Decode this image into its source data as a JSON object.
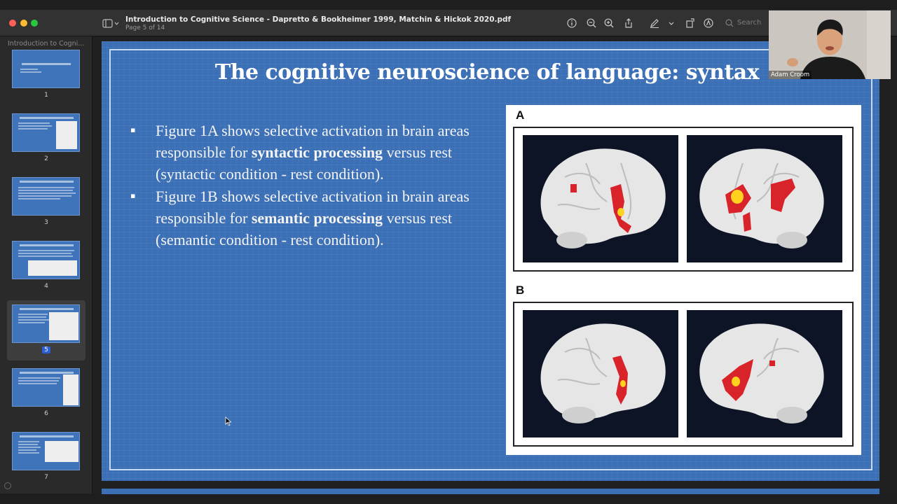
{
  "window": {
    "title": "Introduction to Cognitive Science - Dapretto & Bookheimer 1999, Matchin & Hickok 2020.pdf",
    "subtitle": "Page 5 of 14"
  },
  "toolbar": {
    "search_placeholder": "Search",
    "icons": [
      "info-icon",
      "zoom-out-icon",
      "zoom-in-icon",
      "share-icon",
      "markup-pen-icon",
      "chevron-down-icon",
      "rotate-icon",
      "annotate-icon"
    ]
  },
  "sidebar": {
    "title": "Introduction to Cogni...",
    "pages": [
      {
        "label": "1"
      },
      {
        "label": "2"
      },
      {
        "label": "3"
      },
      {
        "label": "4"
      },
      {
        "label": "5"
      },
      {
        "label": "6"
      },
      {
        "label": "7"
      }
    ],
    "selected_page": "5"
  },
  "slide": {
    "title": "The cognitive neuroscience of language: syntax",
    "bullet1": {
      "pre": "Figure 1A shows selective activation in brain areas responsible for ",
      "bold": "syntactic processing",
      "post": " versus rest (syntactic condition - rest condition)."
    },
    "bullet2": {
      "pre": "Figure 1B shows selective activation in brain areas responsible for ",
      "bold": "semantic processing",
      "post": " versus rest (semantic condition - rest condition)."
    },
    "figure": {
      "panel_a_label": "A",
      "panel_b_label": "B"
    }
  },
  "webcam": {
    "participant_name": "Adam Croom"
  },
  "colors": {
    "slide_background": "#3b6fb6",
    "activation_red": "#d8232a",
    "activation_yellow": "#ffd21f",
    "selected_page_badge": "#2c5fd6"
  }
}
